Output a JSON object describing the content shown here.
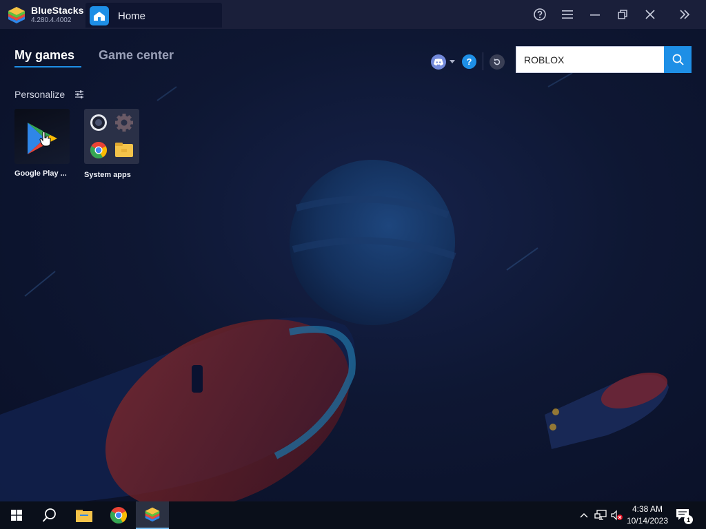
{
  "titlebar": {
    "app_name": "BlueStacks",
    "app_version": "4.280.4.4002",
    "home_tab_label": "Home"
  },
  "nav": {
    "tab_my_games": "My games",
    "tab_game_center": "Game center"
  },
  "personalize": {
    "label": "Personalize"
  },
  "apps": [
    {
      "label": "Google Play ...",
      "icon": "google-play-icon"
    },
    {
      "label": "System apps",
      "icon": "system-apps-folder-icon"
    }
  ],
  "search": {
    "value": "ROBLOX"
  },
  "help_glyph": "?",
  "taskbar": {
    "time": "4:38 AM",
    "date": "10/14/2023",
    "notification_count": "1"
  },
  "colors": {
    "accent": "#1e8fe6",
    "titlebar": "#1a1f3a",
    "background": "#0c1226",
    "discord": "#7289da"
  }
}
